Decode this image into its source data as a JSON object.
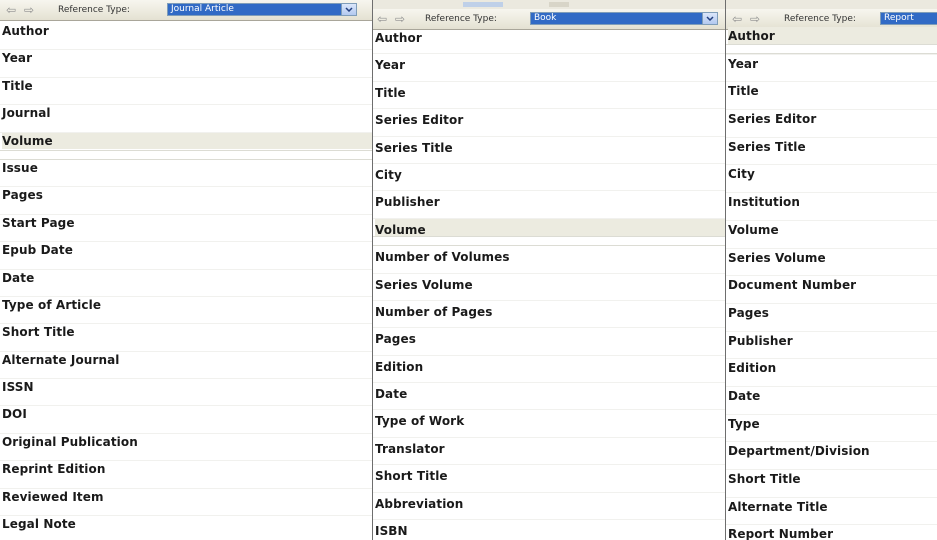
{
  "panels": [
    {
      "reference_type_label": "Reference Type:",
      "reference_type_value": "Journal Article",
      "active_field": "Volume",
      "fields": [
        "Author",
        "Year",
        "Title",
        "Journal",
        "Volume",
        "Issue",
        "Pages",
        "Start Page",
        "Epub Date",
        "Date",
        "Type of Article",
        "Short Title",
        "Alternate Journal",
        "ISSN",
        "DOI",
        "Original Publication",
        "Reprint Edition",
        "Reviewed Item",
        "Legal Note"
      ]
    },
    {
      "reference_type_label": "Reference Type:",
      "reference_type_value": "Book",
      "active_field": "Volume",
      "fields": [
        "Author",
        "Year",
        "Title",
        "Series Editor",
        "Series Title",
        "City",
        "Publisher",
        "Volume",
        "Number of Volumes",
        "Series Volume",
        "Number of Pages",
        "Pages",
        "Edition",
        "Date",
        "Type of Work",
        "Translator",
        "Short Title",
        "Abbreviation",
        "ISBN"
      ]
    },
    {
      "reference_type_label": "Reference Type:",
      "reference_type_value": "Report",
      "active_field": "Author",
      "fields": [
        "Author",
        "Year",
        "Title",
        "Series Editor",
        "Series Title",
        "City",
        "Institution",
        "Volume",
        "Series Volume",
        "Document Number",
        "Pages",
        "Publisher",
        "Edition",
        "Date",
        "Type",
        "Department/Division",
        "Short Title",
        "Alternate Title",
        "Report Number"
      ]
    }
  ],
  "icons": {
    "back": "back-arrow-icon",
    "forward": "forward-arrow-icon",
    "dropdown": "chevron-down-icon"
  },
  "colors": {
    "select_bg": "#316ac5",
    "active_row": "#ecebe0",
    "toolbar": "#ece9d8"
  }
}
